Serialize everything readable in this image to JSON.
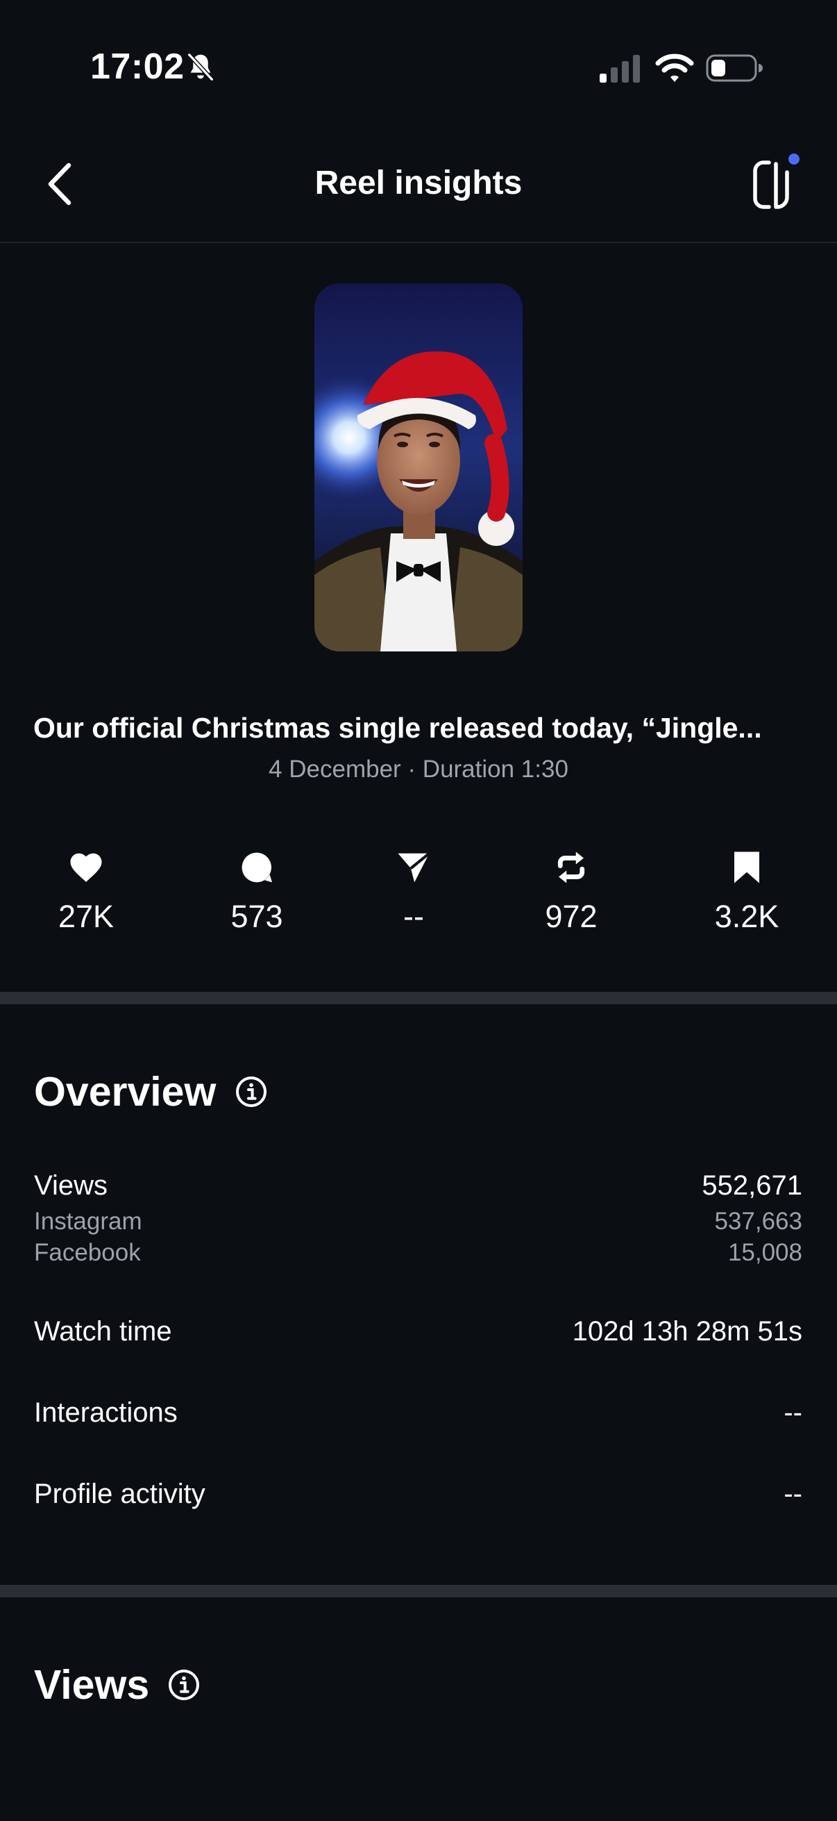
{
  "status_bar": {
    "time": "17:02"
  },
  "header": {
    "title": "Reel insights"
  },
  "reel": {
    "caption": "Our official Christmas single released today, “Jingle...",
    "meta": "4 December · Duration 1:30"
  },
  "stats": [
    {
      "icon": "heart-icon",
      "value": "27K"
    },
    {
      "icon": "comment-icon",
      "value": "573"
    },
    {
      "icon": "share-icon",
      "value": "--"
    },
    {
      "icon": "repost-icon",
      "value": "972"
    },
    {
      "icon": "save-icon",
      "value": "3.2K"
    }
  ],
  "overview": {
    "title": "Overview",
    "views": {
      "label": "Views",
      "value": "552,671"
    },
    "instagram": {
      "label": "Instagram",
      "value": "537,663"
    },
    "facebook": {
      "label": "Facebook",
      "value": "15,008"
    },
    "watch_time": {
      "label": "Watch time",
      "value": "102d 13h 28m 51s"
    },
    "interactions": {
      "label": "Interactions",
      "value": "--"
    },
    "profile_activity": {
      "label": "Profile activity",
      "value": "--"
    }
  },
  "views_section": {
    "title": "Views"
  },
  "colors": {
    "background": "#0b0e12",
    "secondary_text": "#9ea3aa",
    "divider": "#2a2f36",
    "notification_dot": "#4a6cf7"
  }
}
